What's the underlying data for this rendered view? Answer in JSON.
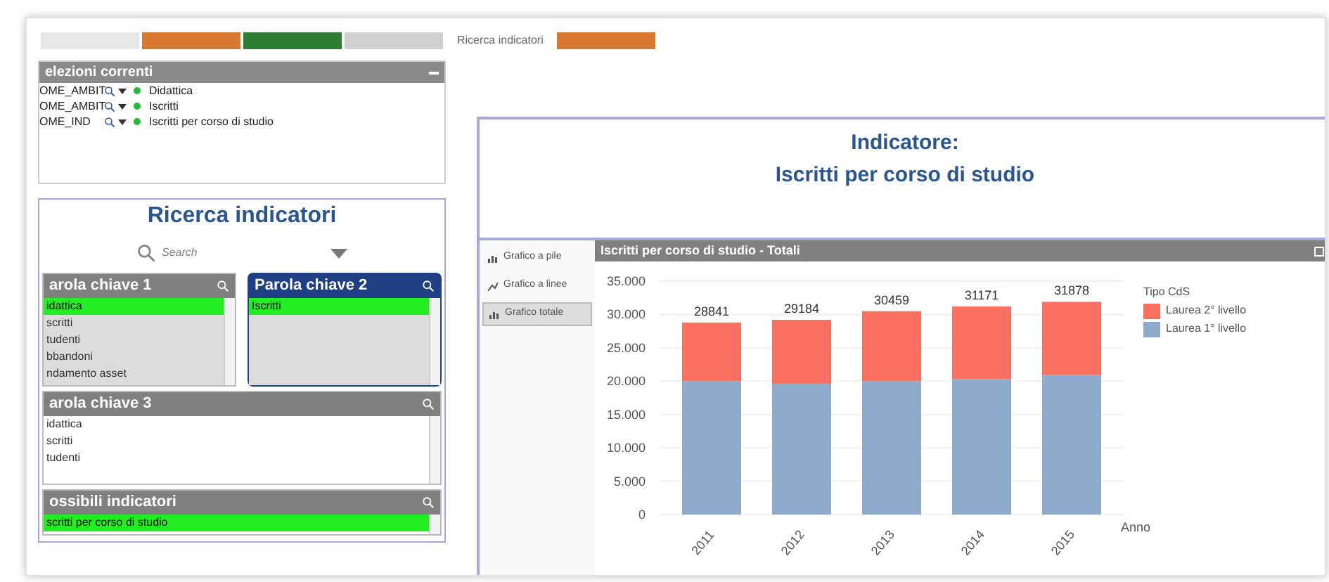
{
  "top_tabs": [
    {
      "color": "#e8e8e8"
    },
    {
      "color": "#d9792f"
    },
    {
      "color": "#2e7d32"
    },
    {
      "color": "#d0d0d0"
    },
    {
      "label": "Ricerca indicatori",
      "color": "#ffffff"
    },
    {
      "color": "#d9792f"
    }
  ],
  "current_selections": {
    "title": "elezioni correnti",
    "rows": [
      {
        "field": "OME_AMBIT",
        "value": "Didattica"
      },
      {
        "field": "OME_AMBIT",
        "value": "Iscritti"
      },
      {
        "field": "OME_IND",
        "value": "Iscritti per corso di studio"
      }
    ]
  },
  "search_panel": {
    "title": "Ricerca indicatori",
    "search": {
      "placeholder": "Search"
    },
    "lists": [
      {
        "title": "arola chiave 1",
        "active": false,
        "items": [
          {
            "label": "idattica",
            "selected": true
          },
          {
            "label": "scritti",
            "selected": false
          },
          {
            "label": "tudenti",
            "selected": false
          },
          {
            "label": "bbandoni",
            "selected": false
          },
          {
            "label": "ndamento asset",
            "selected": false
          }
        ]
      },
      {
        "title": "Parola chiave 2",
        "active": true,
        "items": [
          {
            "label": "Iscritti",
            "selected": true
          }
        ]
      }
    ],
    "list_3": {
      "title": "arola chiave 3",
      "active": false,
      "items": [
        {
          "label": "idattica",
          "selected": false
        },
        {
          "label": "scritti",
          "selected": false
        },
        {
          "label": "tudenti",
          "selected": false
        }
      ]
    },
    "indicators": {
      "title": "ossibili indicatori",
      "active": false,
      "items": [
        {
          "label": "scritti per corso di studio",
          "selected": true
        }
      ]
    }
  },
  "indicator": {
    "heading": "Indicatore:",
    "name": "Iscritti per corso di studio"
  },
  "chart_buttons": [
    {
      "label": "Grafico a pile",
      "kind": "bar",
      "selected": false
    },
    {
      "label": "Grafico a linee",
      "kind": "line",
      "selected": false
    },
    {
      "label": "Grafico totale",
      "kind": "bar",
      "selected": true
    }
  ],
  "chart_panel": {
    "title": "Iscritti per corso di studio - Totali",
    "legend_title": "Tipo CdS",
    "chart_data": {
      "type": "bar",
      "stacked": true,
      "xlabel": "Anno",
      "categories": [
        "2011",
        "2012",
        "2013",
        "2014",
        "2015"
      ],
      "series": [
        {
          "name": "Laurea 1° livello",
          "color": "#8eaacc",
          "values": [
            20000,
            19600,
            20000,
            20300,
            20900
          ]
        },
        {
          "name": "Laurea 2° livello",
          "color": "#fb7060",
          "values": [
            8800,
            9600,
            10500,
            10900,
            11000
          ]
        }
      ],
      "grid": true,
      "ylim": [
        0,
        35000
      ],
      "yticks": [
        {
          "value": 0,
          "label": "0"
        },
        {
          "value": 5000,
          "label": "5.000"
        },
        {
          "value": 10000,
          "label": "10.000"
        },
        {
          "value": 15000,
          "label": "15.000"
        },
        {
          "value": 20000,
          "label": "20.000"
        },
        {
          "value": 25000,
          "label": "25.000"
        },
        {
          "value": 30000,
          "label": "30.000"
        },
        {
          "value": 35000,
          "label": "35.000"
        }
      ],
      "value_labels": [
        "28841",
        "29184",
        "30459",
        "31171",
        "31878"
      ]
    }
  }
}
